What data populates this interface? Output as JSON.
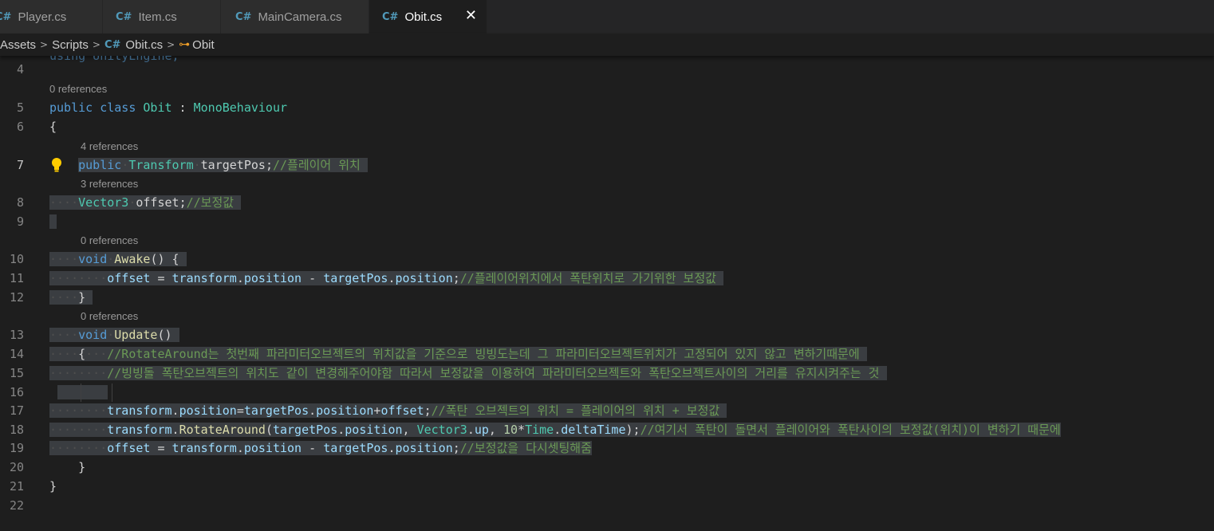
{
  "tabs": [
    {
      "label": "Player.cs",
      "icon": "csharp-file-icon"
    },
    {
      "label": "Item.cs",
      "icon": "csharp-file-icon"
    },
    {
      "label": "MainCamera.cs",
      "icon": "csharp-file-icon"
    },
    {
      "label": "Obit.cs",
      "icon": "csharp-file-icon",
      "active": true,
      "close": "✕"
    }
  ],
  "breadcrumb": {
    "items": [
      "Assets",
      "Scripts",
      "Obit.cs",
      "Obit"
    ],
    "separator": ">"
  },
  "editor": {
    "code_lens": {
      "class": "0 references",
      "targetPos": "4 references",
      "offset": "3 references",
      "awake": "0 references",
      "update": "0 references"
    },
    "line_numbers": [
      "4",
      "5",
      "6",
      "7",
      "8",
      "9",
      "10",
      "11",
      "12",
      "13",
      "14",
      "15",
      "16",
      "17",
      "18",
      "19",
      "20",
      "21",
      "22"
    ],
    "lines": {
      "l3": "using UnityEngine;",
      "l5": {
        "kw1": "public",
        "kw2": "class",
        "name": "Obit",
        "colon": " : ",
        "base": "MonoBehaviour"
      },
      "l6": "{",
      "l7": {
        "kw": "public",
        "type": "Transform",
        "name": "targetPos",
        "semi": ";",
        "comment": "//플레이어 위치"
      },
      "l8": {
        "type": "Vector3",
        "name": "offset",
        "semi": ";",
        "comment": "//보정값"
      },
      "l10": {
        "kw": "void",
        "fn": "Awake",
        "rest": "() {"
      },
      "l11": {
        "v1": "offset",
        "op": " = ",
        "v2": "transform",
        "d1": ".",
        "v3": "position",
        "op2": " - ",
        "v4": "targetPos",
        "d2": ".",
        "v5": "position",
        "semi": ";",
        "comment": "//플레이어위치에서 폭탄위치로 가기위한 보정값"
      },
      "l12": "}",
      "l13": {
        "kw": "void",
        "fn": "Update",
        "rest": "()"
      },
      "l14": {
        "brace": "{",
        "comment": "//RotateAround는 첫번째 파라미터오브젝트의 위치값을 기준으로 빙빙도는데 그 파라미터오브젝트위치가 고정되어 있지 않고 변하기때문에"
      },
      "l15": {
        "comment": "//빙빙돌 폭탄오브젝트의 위치도 같이 변경해주어야함 따라서 보정값을 이용하여 파라미터오브젝트와 폭탄오브젝트사이의 거리를 유지시켜주는 것"
      },
      "l17": {
        "v1": "transform",
        "d1": ".",
        "v2": "position",
        "eq": "=",
        "v3": "targetPos",
        "d2": ".",
        "v4": "position",
        "plus": "+",
        "v5": "offset",
        "semi": ";",
        "comment": "//폭탄 오브젝트의 위치 = 플레이어의 위치 + 보정값"
      },
      "l18": {
        "v1": "transform",
        "d1": ".",
        "fn": "RotateAround",
        "p1": "(",
        "v2": "targetPos",
        "d2": ".",
        "v3": "position",
        "c1": ", ",
        "ty": "Vector3",
        "d3": ".",
        "v4": "up",
        "c2": ", ",
        "num": "10",
        "star": "*",
        "ty2": "Time",
        "d4": ".",
        "v5": "deltaTime",
        "p2": ");",
        "comment": "//여기서 폭탄이 돌면서 플레이어와 폭탄사이의 보정값(위치)이 변하기 때문에"
      },
      "l19": {
        "v1": "offset",
        "op": " = ",
        "v2": "transform",
        "d1": ".",
        "v3": "position",
        "op2": " - ",
        "v4": "targetPos",
        "d2": ".",
        "v5": "position",
        "semi": ";",
        "comment": "//보정값을 다시셋팅해줌"
      },
      "l20": "}",
      "l21": "}"
    }
  },
  "colors": {
    "keyword": "#569cd6",
    "type": "#4ec9b0",
    "function": "#dcdcaa",
    "variable": "#9cdcfe",
    "comment": "#6a9955",
    "number": "#b5cea8",
    "selection": "#3a3d41"
  }
}
